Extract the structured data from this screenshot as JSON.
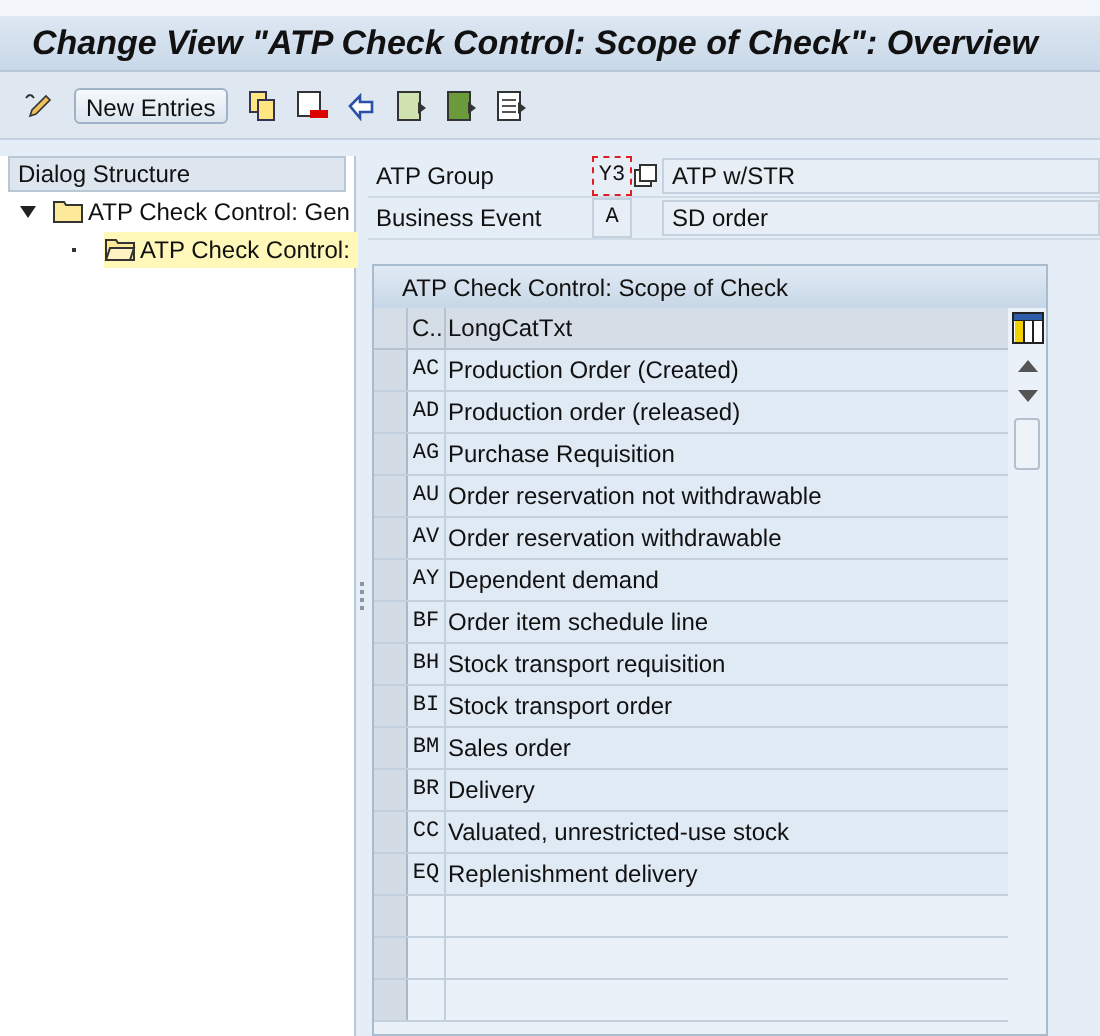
{
  "window": {
    "title": "Change View \"ATP Check Control: Scope of Check\": Overview"
  },
  "toolbar": {
    "new_entries_button": "New Entries"
  },
  "dialog_structure": {
    "title": "Dialog Structure",
    "items": [
      {
        "label": "ATP Check Control: Gen",
        "expanded": true,
        "selected": false,
        "children": [
          {
            "label": "ATP Check Control:",
            "selected": true
          }
        ]
      }
    ]
  },
  "fields": [
    {
      "label": "ATP Group",
      "value": "Y3",
      "focused": true,
      "description": "ATP w/STR"
    },
    {
      "label": "Business Event",
      "value": "A",
      "focused": false,
      "description": "SD order"
    }
  ],
  "table": {
    "title": "ATP Check Control: Scope of Check",
    "columns": [
      "C..",
      "LongCatTxt"
    ],
    "rows": [
      [
        "AC",
        "Production Order (Created)"
      ],
      [
        "AD",
        "Production order (released)"
      ],
      [
        "AG",
        "Purchase Requisition"
      ],
      [
        "AU",
        "Order reservation not withdrawable"
      ],
      [
        "AV",
        "Order reservation withdrawable"
      ],
      [
        "AY",
        "Dependent demand"
      ],
      [
        "BF",
        "Order item schedule line"
      ],
      [
        "BH",
        "Stock transport requisition"
      ],
      [
        "BI",
        "Stock transport order"
      ],
      [
        "BM",
        "Sales order"
      ],
      [
        "BR",
        "Delivery"
      ],
      [
        "CC",
        "Valuated, unrestricted-use stock"
      ],
      [
        "EQ",
        "Replenishment delivery"
      ]
    ]
  }
}
